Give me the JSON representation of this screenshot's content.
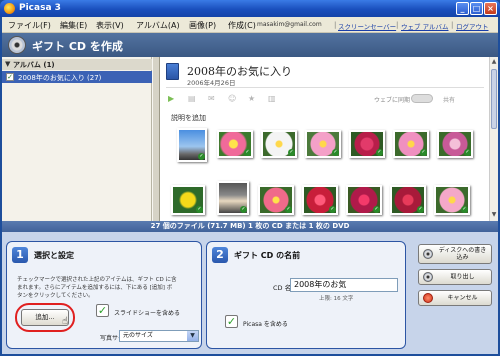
{
  "window": {
    "title": "Picasa 3"
  },
  "menu": {
    "items": [
      "ファイル(F)",
      "編集(E)",
      "表示(V)",
      "アルバム(A)",
      "画像(P)",
      "作成(C)"
    ],
    "email": "masakim@gmail.com",
    "links": [
      "スクリーンセーバー",
      "ウェブ アルバム",
      "ログアウト"
    ]
  },
  "header": {
    "title": "ギフト CD を作成"
  },
  "sidebar": {
    "group_label": "アルバム (1)",
    "album_label": "2008年のお気に入り (27)"
  },
  "album": {
    "title": "2008年のお気に入り",
    "date": "2006年4月26日",
    "sync_label": "ウェブに同期",
    "share_label": "共有",
    "caption_prompt": "説明を追加"
  },
  "status": {
    "text": "27 個のファイル (71.7 MB) 1 枚の CD または 1 枚の DVD"
  },
  "step1": {
    "number": "1",
    "title": "選択と設定",
    "description": "チェックマークで選択された上記のアイテムは、ギフト CD に含まれます。さらにアイテムを追加するには、下にある [追加] ボタンをクリックしてください。",
    "add_button": "追加...",
    "slideshow_label": "スライドショーを含める",
    "photo_size_label": "写真サイズ",
    "photo_size_value": "元のサイズ"
  },
  "step2": {
    "number": "2",
    "title": "ギフト CD の名前",
    "cd_name_label": "CD 名",
    "cd_name_value": "2008年のお気",
    "limit_text": "上限: 16 文字",
    "picasa_label": "Picasa を含める"
  },
  "actions": {
    "burn": "ディスクへの書き込み",
    "eject": "取り出し",
    "cancel": "キャンセル"
  },
  "colors": {
    "titlebar": "#1a4fbd",
    "header": "#4a6a96",
    "accent_blue": "#2c55a4",
    "check_green": "#2aa02a",
    "highlight_red": "#e02020"
  },
  "icons": [
    "cd-icon",
    "album-icon",
    "play-icon",
    "checkmark-icon",
    "star-icon",
    "cursor-icon"
  ]
}
